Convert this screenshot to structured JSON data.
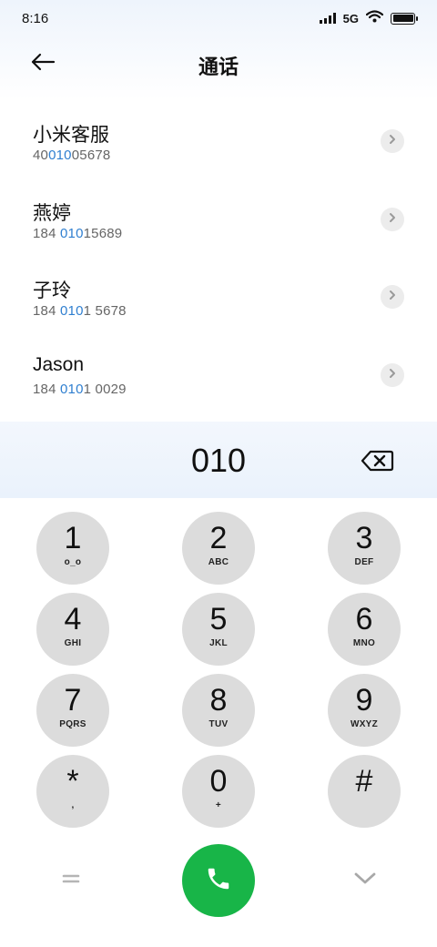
{
  "status_bar": {
    "time": "8:16",
    "network": "5G",
    "icons": [
      "signal-icon",
      "wifi-icon",
      "battery-icon"
    ]
  },
  "header": {
    "title": "通话",
    "back_icon": "arrow-left-icon"
  },
  "contacts": [
    {
      "name": "小米客服",
      "number_parts": [
        "40",
        "010",
        "05678"
      ]
    },
    {
      "name": "燕婷",
      "number_parts": [
        "184 ",
        "010",
        "15689"
      ]
    },
    {
      "name": "子玲",
      "number_parts": [
        "184 ",
        "010",
        "1 5678"
      ]
    },
    {
      "name": "Jason",
      "number_parts": [
        "184 ",
        "010",
        "1 0029"
      ]
    }
  ],
  "dial": {
    "input": "010",
    "delete_icon": "backspace-icon"
  },
  "keypad": [
    {
      "digit": "1",
      "letters": "o_o"
    },
    {
      "digit": "2",
      "letters": "ABC"
    },
    {
      "digit": "3",
      "letters": "DEF"
    },
    {
      "digit": "4",
      "letters": "GHI"
    },
    {
      "digit": "5",
      "letters": "JKL"
    },
    {
      "digit": "6",
      "letters": "MNO"
    },
    {
      "digit": "7",
      "letters": "PQRS"
    },
    {
      "digit": "8",
      "letters": "TUV"
    },
    {
      "digit": "9",
      "letters": "WXYZ"
    },
    {
      "digit": "*",
      "letters": ","
    },
    {
      "digit": "0",
      "letters": "+"
    },
    {
      "digit": "#",
      "letters": ""
    }
  ],
  "bottom_bar": {
    "menu_icon": "menu-icon",
    "call_icon": "phone-icon",
    "collapse_icon": "chevron-down-icon"
  },
  "colors": {
    "highlight": "#2f7fd0",
    "call_green": "#18b548",
    "key_bg": "#dcdcdc"
  }
}
